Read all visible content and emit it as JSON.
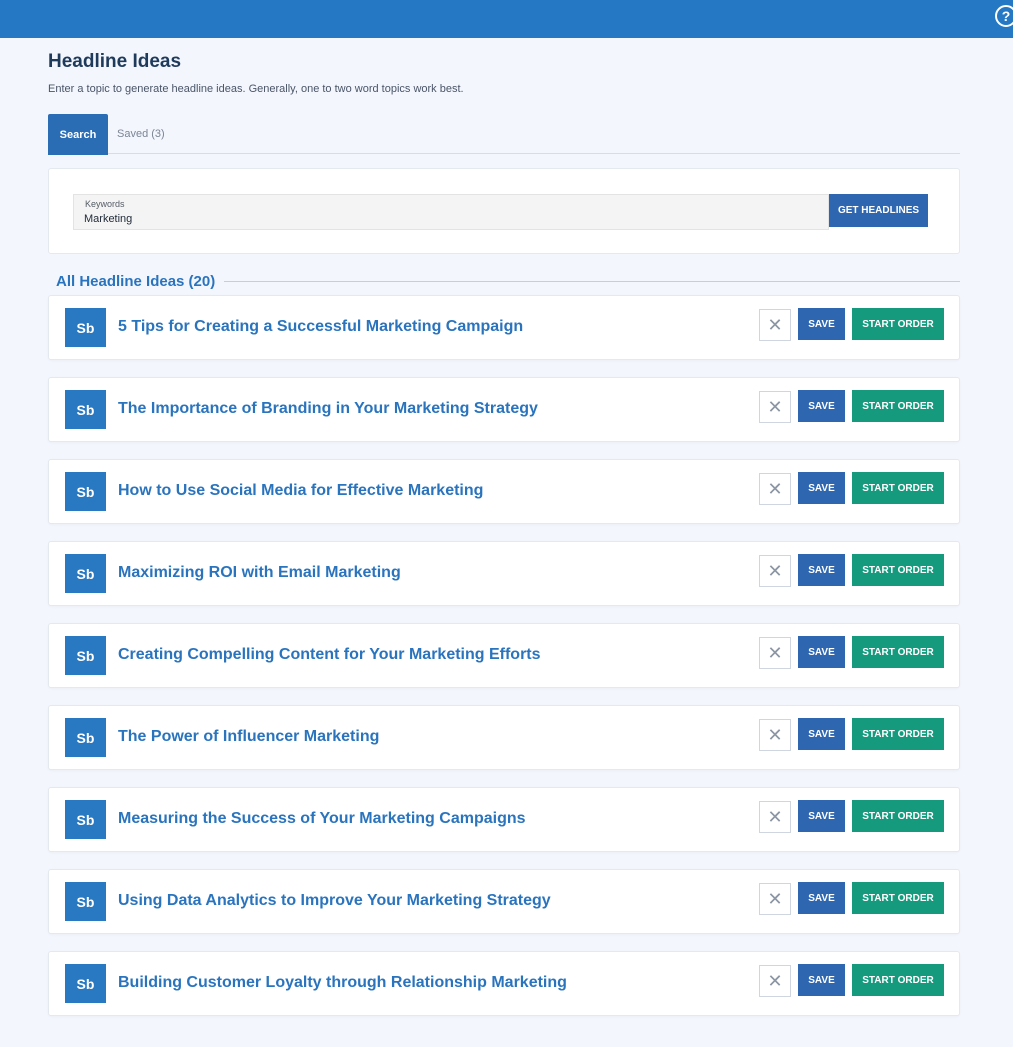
{
  "header": {
    "help_icon": "question-circle-icon",
    "help_symbol": "?"
  },
  "page": {
    "title": "Headline Ideas",
    "subtitle": "Enter a topic to generate headline ideas. Generally, one to two word topics work best."
  },
  "tabs": [
    {
      "label": "Search",
      "active": true
    },
    {
      "label": "Saved (3)",
      "active": false
    }
  ],
  "search": {
    "label": "Keywords",
    "value": "Marketing",
    "button_label": "GET HEADLINES"
  },
  "results": {
    "heading": "All Headline Ideas (20)",
    "badge": "Sb",
    "dismiss_symbol": "✕",
    "save_label": "SAVE",
    "order_label": "START ORDER",
    "items": [
      {
        "title": "5 Tips for Creating a Successful Marketing Campaign"
      },
      {
        "title": "The Importance of Branding in Your Marketing Strategy"
      },
      {
        "title": "How to Use Social Media for Effective Marketing"
      },
      {
        "title": "Maximizing ROI with Email Marketing"
      },
      {
        "title": "Creating Compelling Content for Your Marketing Efforts"
      },
      {
        "title": "The Power of Influencer Marketing"
      },
      {
        "title": "Measuring the Success of Your Marketing Campaigns"
      },
      {
        "title": "Using Data Analytics to Improve Your Marketing Strategy"
      },
      {
        "title": "Building Customer Loyalty through Relationship Marketing"
      }
    ]
  },
  "colors": {
    "topbar": "#2478c4",
    "primary": "#2f66b0",
    "accent_green": "#169a7e",
    "link_blue": "#2a74be",
    "background": "#f3f6fd"
  }
}
